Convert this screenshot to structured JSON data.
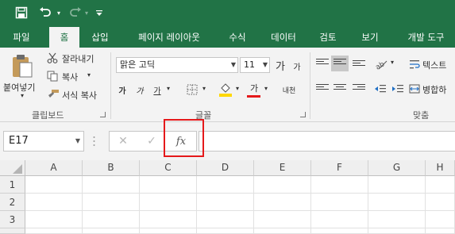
{
  "quick_access": {
    "save_icon": "save-icon",
    "undo_icon": "undo-icon",
    "redo_icon": "redo-icon",
    "customize_icon": "customize-qat-icon"
  },
  "tabs": [
    {
      "label": "파일",
      "active": false
    },
    {
      "label": "홈",
      "active": true
    },
    {
      "label": "삽입",
      "active": false
    },
    {
      "label": "페이지 레이아웃",
      "active": false
    },
    {
      "label": "수식",
      "active": false
    },
    {
      "label": "데이터",
      "active": false
    },
    {
      "label": "검토",
      "active": false
    },
    {
      "label": "보기",
      "active": false
    },
    {
      "label": "개발 도구",
      "active": false
    }
  ],
  "clipboard": {
    "paste_label": "붙여넣기",
    "cut_label": "잘라내기",
    "copy_label": "복사",
    "format_painter_label": "서식 복사",
    "group_label": "클립보드"
  },
  "font": {
    "font_name": "맑은 고딕",
    "font_size": "11",
    "grow_label": "가",
    "shrink_label": "가",
    "bold_label": "가",
    "italic_label": "가",
    "underline_label": "가",
    "font_color_label": "가",
    "phonetic_label": "내천",
    "group_label": "글꼴"
  },
  "alignment": {
    "wrap_text_label": "텍스트",
    "merge_label": "병합하",
    "group_label": "맞춤"
  },
  "formula_bar": {
    "name_box": "E17",
    "cancel_icon": "✕",
    "enter_icon": "✓",
    "fx_label": "fx",
    "formula": ""
  },
  "grid": {
    "columns": [
      "A",
      "B",
      "C",
      "D",
      "E",
      "F",
      "G",
      "H"
    ],
    "rows": [
      "1",
      "2",
      "3"
    ]
  },
  "colors": {
    "excel_green": "#217346",
    "highlight": "#e5191b",
    "underline_red": "#e5191b",
    "fill_yellow": "#ffd800"
  }
}
